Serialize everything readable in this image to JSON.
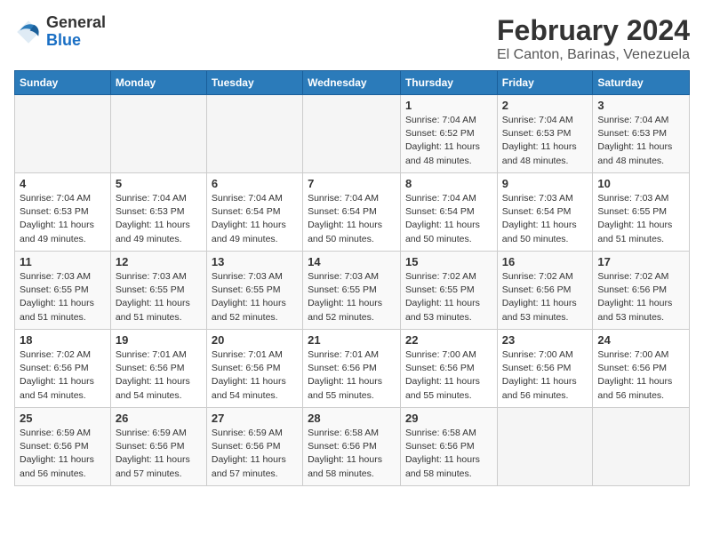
{
  "logo": {
    "general": "General",
    "blue": "Blue"
  },
  "title": "February 2024",
  "subtitle": "El Canton, Barinas, Venezuela",
  "days_of_week": [
    "Sunday",
    "Monday",
    "Tuesday",
    "Wednesday",
    "Thursday",
    "Friday",
    "Saturday"
  ],
  "weeks": [
    [
      {
        "day": "",
        "info": ""
      },
      {
        "day": "",
        "info": ""
      },
      {
        "day": "",
        "info": ""
      },
      {
        "day": "",
        "info": ""
      },
      {
        "day": "1",
        "info": "Sunrise: 7:04 AM\nSunset: 6:52 PM\nDaylight: 11 hours\nand 48 minutes."
      },
      {
        "day": "2",
        "info": "Sunrise: 7:04 AM\nSunset: 6:53 PM\nDaylight: 11 hours\nand 48 minutes."
      },
      {
        "day": "3",
        "info": "Sunrise: 7:04 AM\nSunset: 6:53 PM\nDaylight: 11 hours\nand 48 minutes."
      }
    ],
    [
      {
        "day": "4",
        "info": "Sunrise: 7:04 AM\nSunset: 6:53 PM\nDaylight: 11 hours\nand 49 minutes."
      },
      {
        "day": "5",
        "info": "Sunrise: 7:04 AM\nSunset: 6:53 PM\nDaylight: 11 hours\nand 49 minutes."
      },
      {
        "day": "6",
        "info": "Sunrise: 7:04 AM\nSunset: 6:54 PM\nDaylight: 11 hours\nand 49 minutes."
      },
      {
        "day": "7",
        "info": "Sunrise: 7:04 AM\nSunset: 6:54 PM\nDaylight: 11 hours\nand 50 minutes."
      },
      {
        "day": "8",
        "info": "Sunrise: 7:04 AM\nSunset: 6:54 PM\nDaylight: 11 hours\nand 50 minutes."
      },
      {
        "day": "9",
        "info": "Sunrise: 7:03 AM\nSunset: 6:54 PM\nDaylight: 11 hours\nand 50 minutes."
      },
      {
        "day": "10",
        "info": "Sunrise: 7:03 AM\nSunset: 6:55 PM\nDaylight: 11 hours\nand 51 minutes."
      }
    ],
    [
      {
        "day": "11",
        "info": "Sunrise: 7:03 AM\nSunset: 6:55 PM\nDaylight: 11 hours\nand 51 minutes."
      },
      {
        "day": "12",
        "info": "Sunrise: 7:03 AM\nSunset: 6:55 PM\nDaylight: 11 hours\nand 51 minutes."
      },
      {
        "day": "13",
        "info": "Sunrise: 7:03 AM\nSunset: 6:55 PM\nDaylight: 11 hours\nand 52 minutes."
      },
      {
        "day": "14",
        "info": "Sunrise: 7:03 AM\nSunset: 6:55 PM\nDaylight: 11 hours\nand 52 minutes."
      },
      {
        "day": "15",
        "info": "Sunrise: 7:02 AM\nSunset: 6:55 PM\nDaylight: 11 hours\nand 53 minutes."
      },
      {
        "day": "16",
        "info": "Sunrise: 7:02 AM\nSunset: 6:56 PM\nDaylight: 11 hours\nand 53 minutes."
      },
      {
        "day": "17",
        "info": "Sunrise: 7:02 AM\nSunset: 6:56 PM\nDaylight: 11 hours\nand 53 minutes."
      }
    ],
    [
      {
        "day": "18",
        "info": "Sunrise: 7:02 AM\nSunset: 6:56 PM\nDaylight: 11 hours\nand 54 minutes."
      },
      {
        "day": "19",
        "info": "Sunrise: 7:01 AM\nSunset: 6:56 PM\nDaylight: 11 hours\nand 54 minutes."
      },
      {
        "day": "20",
        "info": "Sunrise: 7:01 AM\nSunset: 6:56 PM\nDaylight: 11 hours\nand 54 minutes."
      },
      {
        "day": "21",
        "info": "Sunrise: 7:01 AM\nSunset: 6:56 PM\nDaylight: 11 hours\nand 55 minutes."
      },
      {
        "day": "22",
        "info": "Sunrise: 7:00 AM\nSunset: 6:56 PM\nDaylight: 11 hours\nand 55 minutes."
      },
      {
        "day": "23",
        "info": "Sunrise: 7:00 AM\nSunset: 6:56 PM\nDaylight: 11 hours\nand 56 minutes."
      },
      {
        "day": "24",
        "info": "Sunrise: 7:00 AM\nSunset: 6:56 PM\nDaylight: 11 hours\nand 56 minutes."
      }
    ],
    [
      {
        "day": "25",
        "info": "Sunrise: 6:59 AM\nSunset: 6:56 PM\nDaylight: 11 hours\nand 56 minutes."
      },
      {
        "day": "26",
        "info": "Sunrise: 6:59 AM\nSunset: 6:56 PM\nDaylight: 11 hours\nand 57 minutes."
      },
      {
        "day": "27",
        "info": "Sunrise: 6:59 AM\nSunset: 6:56 PM\nDaylight: 11 hours\nand 57 minutes."
      },
      {
        "day": "28",
        "info": "Sunrise: 6:58 AM\nSunset: 6:56 PM\nDaylight: 11 hours\nand 58 minutes."
      },
      {
        "day": "29",
        "info": "Sunrise: 6:58 AM\nSunset: 6:56 PM\nDaylight: 11 hours\nand 58 minutes."
      },
      {
        "day": "",
        "info": ""
      },
      {
        "day": "",
        "info": ""
      }
    ]
  ]
}
